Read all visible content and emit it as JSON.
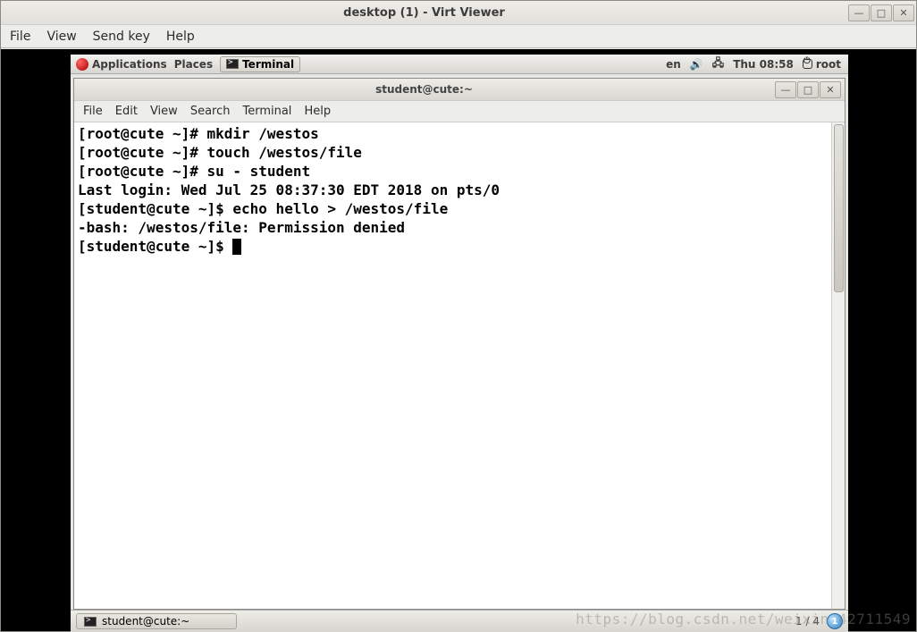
{
  "outer": {
    "title": "desktop (1) - Virt Viewer",
    "menus": {
      "file": "File",
      "view": "View",
      "sendkey": "Send key",
      "help": "Help"
    },
    "win": {
      "min": "—",
      "max": "□",
      "close": "✕"
    }
  },
  "gnome": {
    "applications": "Applications",
    "places": "Places",
    "terminal_launcher": "Terminal",
    "lang": "en",
    "clock": "Thu 08:58",
    "user": "root"
  },
  "terminal": {
    "title": "student@cute:~",
    "menus": {
      "file": "File",
      "edit": "Edit",
      "view": "View",
      "search": "Search",
      "terminal": "Terminal",
      "help": "Help"
    },
    "lines": [
      "[root@cute ~]# mkdir /westos",
      "[root@cute ~]# touch /westos/file",
      "[root@cute ~]# su - student",
      "Last login: Wed Jul 25 08:37:30 EDT 2018 on pts/0",
      "[student@cute ~]$ echo hello > /westos/file",
      "-bash: /westos/file: Permission denied",
      "[student@cute ~]$ "
    ]
  },
  "taskbar": {
    "item": "student@cute:~"
  },
  "pager": {
    "text": "1 / 4",
    "badge": "1"
  },
  "watermark": "https://blog.csdn.net/weixin_42711549"
}
